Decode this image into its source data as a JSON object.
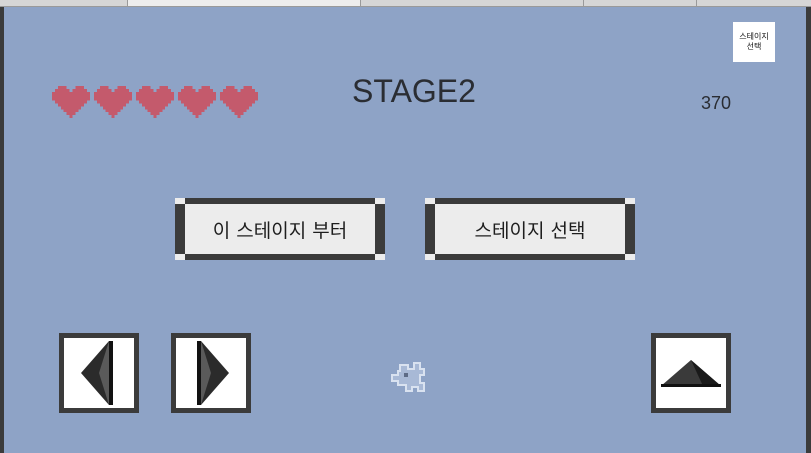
{
  "game": {
    "stage_title": "STAGE2",
    "score": "370",
    "lives": 5,
    "stage_select_small_label": "스테이지 선택",
    "restart_button_label": "이 스테이지 부터",
    "stage_select_button_label": "스테이지 선택",
    "controls": {
      "left_icon": "arrow-left-icon",
      "right_icon": "arrow-right-icon",
      "jump_icon": "arrow-up-icon"
    },
    "colors": {
      "background": "#8ea3c6",
      "heart": "#c45a6c",
      "text": "#2a2d33"
    }
  }
}
